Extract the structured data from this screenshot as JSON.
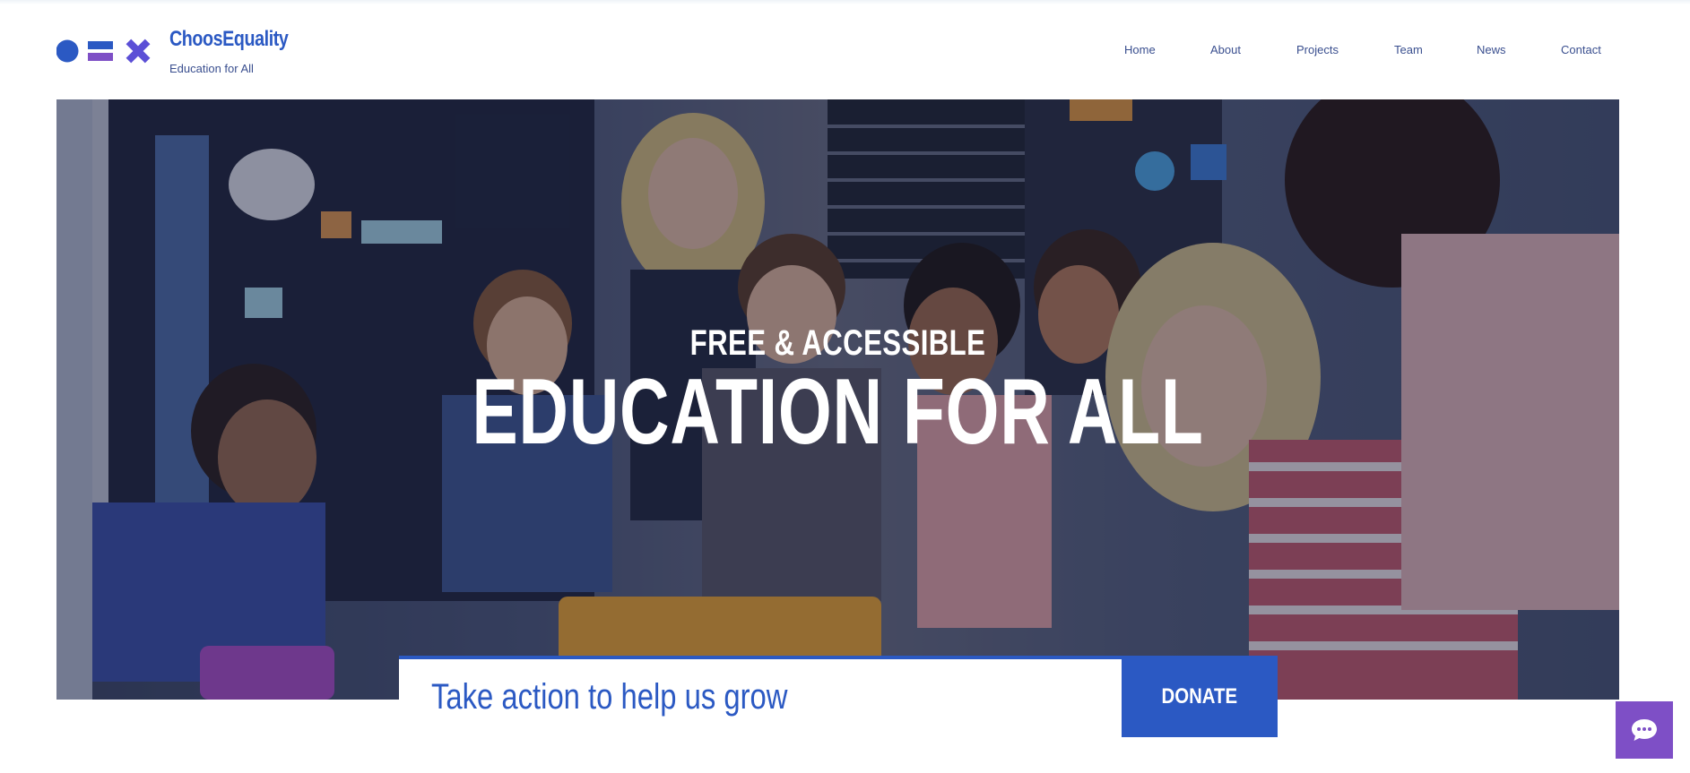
{
  "brand": {
    "name": "ChoosEquality",
    "tagline": "Education for All",
    "logo": [
      "circle-icon",
      "equals-icon",
      "x-icon"
    ],
    "colors": {
      "primary": "#2b59c3",
      "secondary": "#7e4fc6"
    }
  },
  "nav": {
    "items": [
      {
        "label": "Home"
      },
      {
        "label": "About"
      },
      {
        "label": "Projects"
      },
      {
        "label": "Team"
      },
      {
        "label": "News"
      },
      {
        "label": "Contact"
      }
    ]
  },
  "hero": {
    "eyebrow": "FREE & ACCESSIBLE",
    "title": "EDUCATION FOR ALL",
    "image": "teacher-with-children-photo"
  },
  "cta": {
    "text": "Take action to help us grow",
    "button_label": "DONATE"
  },
  "chat": {
    "icon": "chat-bubble-icon"
  }
}
